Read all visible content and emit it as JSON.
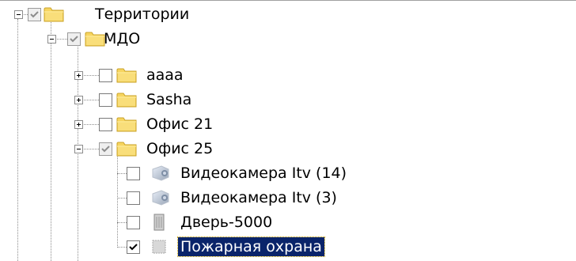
{
  "tree": {
    "nodes": [
      {
        "id": "territories",
        "label": "Территории",
        "expander": "minus",
        "check": "grayed-checked",
        "icon": "folder-icon"
      },
      {
        "id": "mdo",
        "label": "МДО",
        "expander": "minus",
        "check": "grayed-checked",
        "icon": "folder-icon"
      },
      {
        "id": "aaaa",
        "label": "аааа",
        "expander": "plus",
        "check": "unchecked",
        "icon": "folder-icon"
      },
      {
        "id": "sasha",
        "label": "Sasha",
        "expander": "plus",
        "check": "unchecked",
        "icon": "folder-icon"
      },
      {
        "id": "office21",
        "label": "Офис 21",
        "expander": "plus",
        "check": "unchecked",
        "icon": "folder-icon"
      },
      {
        "id": "office25",
        "label": "Офис 25",
        "expander": "minus",
        "check": "grayed-checked",
        "icon": "folder-icon"
      },
      {
        "id": "camera14",
        "label": "Видеокамера Itv (14)",
        "expander": "none",
        "check": "unchecked",
        "icon": "camera-icon"
      },
      {
        "id": "camera3",
        "label": "Видеокамера Itv (3)",
        "expander": "none",
        "check": "unchecked",
        "icon": "camera-icon"
      },
      {
        "id": "door5000",
        "label": "Дверь-5000",
        "expander": "none",
        "check": "unchecked",
        "icon": "door-icon"
      },
      {
        "id": "fire",
        "label": "Пожарная охрана",
        "expander": "none",
        "check": "checked",
        "icon": "fire-alarm-icon",
        "selected": true
      }
    ]
  },
  "colors": {
    "selection_bg": "#0a246a",
    "folder_yellow": "#f7d560",
    "check_gray": "#8c8c8c",
    "tree_lines": "#8c8c8c"
  }
}
